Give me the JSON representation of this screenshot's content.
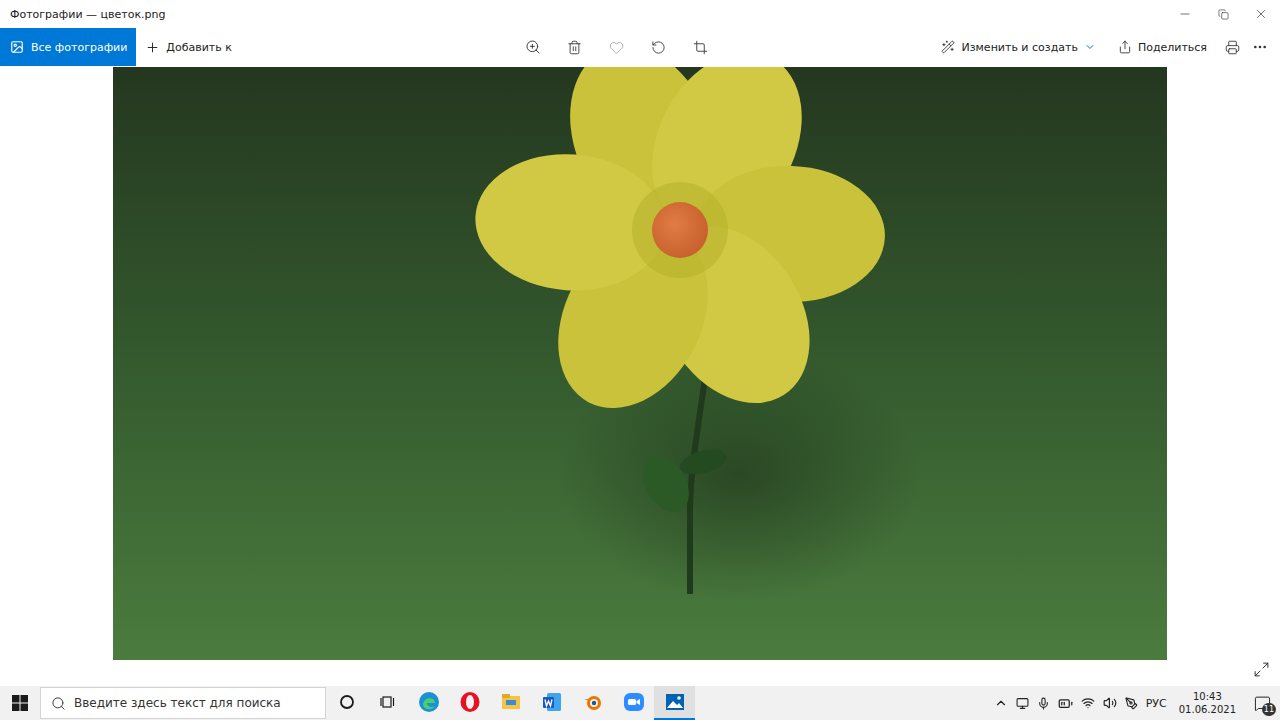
{
  "window": {
    "title": "Фотографии — цветок.png"
  },
  "toolbar": {
    "home": {
      "label": "Все фотографии",
      "selected": true
    },
    "add": "Добавить к",
    "favorite": false,
    "edit": "Изменить и создать",
    "share": "Поделиться"
  },
  "taskbar": {
    "search_placeholder": "Введите здесь текст для поиска",
    "apps": [
      {
        "kind": "edge",
        "selected": false
      },
      {
        "kind": "opera",
        "selected": false
      },
      {
        "kind": "explorer",
        "selected": false
      },
      {
        "kind": "word",
        "selected": false
      },
      {
        "kind": "blender",
        "selected": false
      },
      {
        "kind": "zoom",
        "selected": false
      },
      {
        "kind": "photos",
        "selected": true
      }
    ],
    "language": "РУС",
    "time": "10:43",
    "date": "01.06.2021",
    "notifications": "11"
  }
}
